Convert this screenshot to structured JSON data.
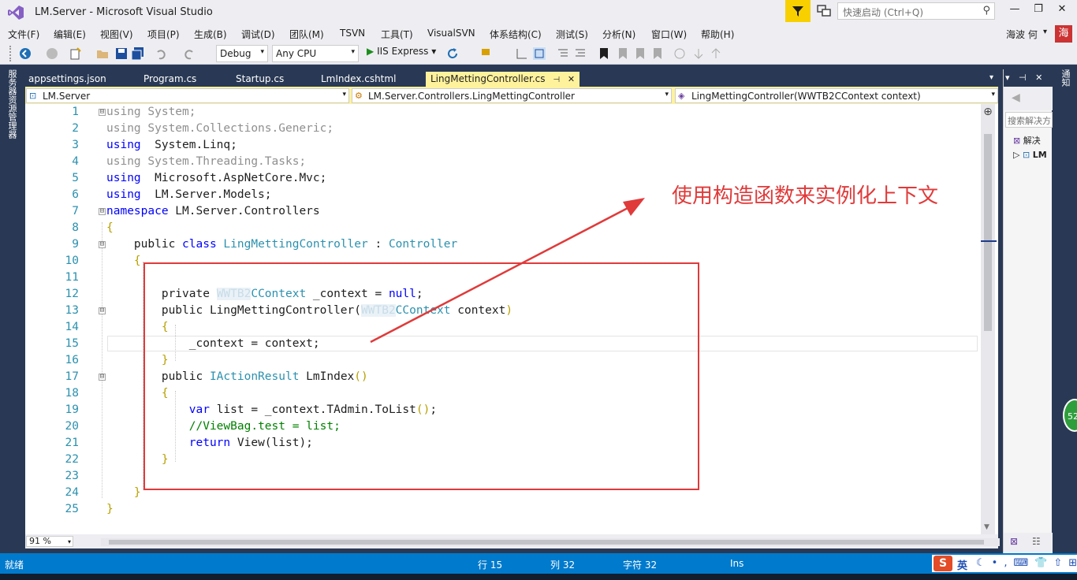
{
  "window": {
    "title": "LM.Server - Microsoft Visual Studio",
    "quick_launch_placeholder": "快速启动 (Ctrl+Q)",
    "minimize": "—",
    "maximize": "❐",
    "close": "✕"
  },
  "menu": {
    "items": [
      "文件(F)",
      "编辑(E)",
      "视图(V)",
      "项目(P)",
      "生成(B)",
      "调试(D)",
      "团队(M)",
      "TSVN",
      "工具(T)",
      "VisualSVN",
      "体系结构(C)",
      "测试(S)",
      "分析(N)",
      "窗口(W)",
      "帮助(H)"
    ],
    "user": "海波 何",
    "user_arrow": "▾",
    "avatar": "海"
  },
  "toolbar": {
    "config": "Debug",
    "platform": "Any CPU",
    "run_target": "IIS Express",
    "combo_arrow": "▾"
  },
  "left_strip": {
    "label": "服务器资源管理器"
  },
  "tabs": [
    {
      "label": "appsettings.json",
      "active": false
    },
    {
      "label": "Program.cs",
      "active": false
    },
    {
      "label": "Startup.cs",
      "active": false
    },
    {
      "label": "LmIndex.cshtml",
      "active": false
    },
    {
      "label": "LingMettingController.cs",
      "active": true
    }
  ],
  "tab_controls": {
    "pin": "⊣",
    "close": "✕",
    "overflow": "▾"
  },
  "navbar": {
    "project": "LM.Server",
    "class": "LM.Server.Controllers.LingMettingController",
    "member": "LingMettingController(WWTB2CContext context)"
  },
  "code_lines": [
    {
      "n": "1",
      "fold": "⊟",
      "tokens": [
        [
          "dim",
          "using System;"
        ]
      ]
    },
    {
      "n": "2",
      "fold": "",
      "tokens": [
        [
          "dim",
          "using System.Collections.Generic;"
        ]
      ]
    },
    {
      "n": "3",
      "fold": "",
      "tokens": [
        [
          "kw",
          "using"
        ],
        [
          "",
          "  System.Linq;"
        ]
      ]
    },
    {
      "n": "4",
      "fold": "",
      "tokens": [
        [
          "dim",
          "using System.Threading.Tasks;"
        ]
      ]
    },
    {
      "n": "5",
      "fold": "",
      "tokens": [
        [
          "kw",
          "using"
        ],
        [
          "",
          "  Microsoft.AspNetCore.Mvc;"
        ]
      ]
    },
    {
      "n": "6",
      "fold": "",
      "tokens": [
        [
          "kw",
          "using"
        ],
        [
          "",
          "  LM.Server.Models;"
        ]
      ]
    },
    {
      "n": "7",
      "fold": "⊟",
      "tokens": [
        [
          "kw",
          "namespace"
        ],
        [
          "",
          " LM.Server.Controllers"
        ]
      ]
    },
    {
      "n": "8",
      "fold": "",
      "tokens": [
        [
          "br",
          "{"
        ]
      ]
    },
    {
      "n": "9",
      "fold": "⊟",
      "tokens": [
        [
          "",
          "    public "
        ],
        [
          "kw",
          "class"
        ],
        [
          "",
          " "
        ],
        [
          "ty",
          "LingMettingController"
        ],
        [
          "",
          " : "
        ],
        [
          "ty",
          "Controller"
        ]
      ]
    },
    {
      "n": "10",
      "fold": "",
      "tokens": [
        [
          "br",
          "    {"
        ]
      ]
    },
    {
      "n": "11",
      "fold": "",
      "tokens": []
    },
    {
      "n": "12",
      "fold": "",
      "tokens": [
        [
          "",
          "        private "
        ],
        [
          "blur",
          "WWTB2"
        ],
        [
          "ty",
          "CContext"
        ],
        [
          "",
          " _context = "
        ],
        [
          "kw",
          "null"
        ],
        [
          "",
          ";"
        ]
      ]
    },
    {
      "n": "13",
      "fold": "⊟",
      "tokens": [
        [
          "",
          "        public LingMettingController("
        ],
        [
          "blur",
          "WWTB2"
        ],
        [
          "ty",
          "CContext"
        ],
        [
          "",
          " context"
        ],
        [
          "br",
          ")"
        ]
      ]
    },
    {
      "n": "14",
      "fold": "",
      "tokens": [
        [
          "br",
          "        {"
        ]
      ]
    },
    {
      "n": "15",
      "fold": "",
      "tokens": [
        [
          "",
          "            _context = context;"
        ]
      ]
    },
    {
      "n": "16",
      "fold": "",
      "tokens": [
        [
          "br",
          "        }"
        ]
      ]
    },
    {
      "n": "17",
      "fold": "⊟",
      "tokens": [
        [
          "",
          "        public "
        ],
        [
          "ty",
          "IActionResult"
        ],
        [
          "",
          " LmIndex"
        ],
        [
          "br",
          "()"
        ]
      ]
    },
    {
      "n": "18",
      "fold": "",
      "tokens": [
        [
          "br",
          "        {"
        ]
      ]
    },
    {
      "n": "19",
      "fold": "",
      "tokens": [
        [
          "",
          "            "
        ],
        [
          "kw",
          "var"
        ],
        [
          "",
          " list = _context.TAdmin.ToList"
        ],
        [
          "br",
          "()"
        ],
        [
          "",
          ";"
        ]
      ]
    },
    {
      "n": "20",
      "fold": "",
      "tokens": [
        [
          "",
          "            "
        ],
        [
          "cm",
          "//ViewBag.test = list;"
        ]
      ]
    },
    {
      "n": "21",
      "fold": "",
      "tokens": [
        [
          "",
          "            "
        ],
        [
          "kw",
          "return"
        ],
        [
          "",
          " View(list);"
        ]
      ]
    },
    {
      "n": "22",
      "fold": "",
      "tokens": [
        [
          "br",
          "        }"
        ]
      ]
    },
    {
      "n": "23",
      "fold": "",
      "tokens": []
    },
    {
      "n": "24",
      "fold": "",
      "tokens": [
        [
          "br",
          "    }"
        ]
      ]
    },
    {
      "n": "25",
      "fold": "",
      "tokens": [
        [
          "br",
          "}"
        ]
      ]
    }
  ],
  "annotation": {
    "text": "使用构造函数来实例化上下文"
  },
  "zoom": "91 %",
  "right_panel": {
    "search_placeholder": "搜索解决方",
    "item1": "解决",
    "item2": "LM",
    "strip_label": "通知",
    "badge": "52"
  },
  "status": {
    "ready": "就绪",
    "line": "行 15",
    "col": "列 32",
    "char": "字符 32",
    "mode": "Ins",
    "ime_s": "S",
    "ime_lang": "英",
    "ime_icons": "☾•,⌨👕⇧⊞"
  }
}
